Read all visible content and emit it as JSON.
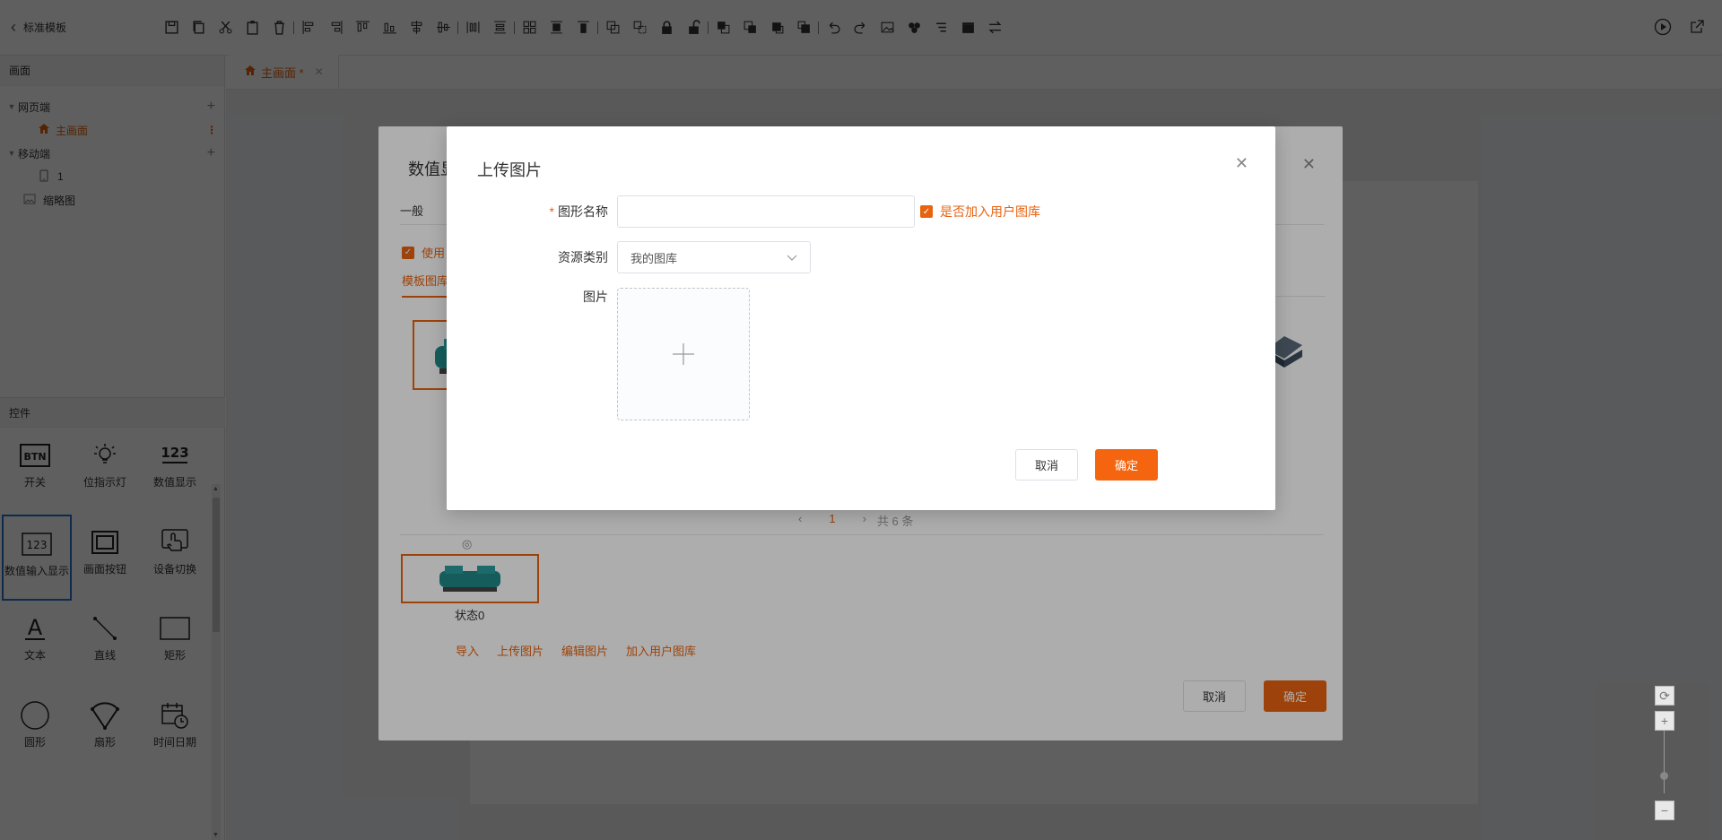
{
  "topbar": {
    "back_label": "标准模板"
  },
  "left": {
    "panel_title": "画面",
    "web_group": "网页端",
    "main_page": "主画面",
    "mobile_group": "移动端",
    "mobile_item": "1",
    "thumbnail": "缩略图",
    "controls_title": "控件",
    "controls": [
      {
        "label": "开关",
        "icon": "btn-icon"
      },
      {
        "label": "位指示灯",
        "icon": "bulb-icon"
      },
      {
        "label": "数值显示",
        "icon": "number-display-icon"
      },
      {
        "label": "数值输入显示",
        "icon": "number-input-icon"
      },
      {
        "label": "画面按钮",
        "icon": "frame-button-icon"
      },
      {
        "label": "设备切换",
        "icon": "device-switch-icon"
      },
      {
        "label": "文本",
        "icon": "text-icon"
      },
      {
        "label": "直线",
        "icon": "line-icon"
      },
      {
        "label": "矩形",
        "icon": "rectangle-icon"
      },
      {
        "label": "圆形",
        "icon": "circle-icon"
      },
      {
        "label": "扇形",
        "icon": "sector-icon"
      },
      {
        "label": "时间日期",
        "icon": "datetime-icon"
      }
    ]
  },
  "tabs": {
    "main_tab": "主画面 *"
  },
  "dialog_back": {
    "title": "数值显",
    "tab_general": "一般",
    "use_label": "使用",
    "subtab": "模板图库",
    "pager_current": "1",
    "pager_total": "共 6 条",
    "state_label": "状态0",
    "links": [
      "导入",
      "上传图片",
      "编辑图片",
      "加入用户图库"
    ],
    "cancel": "取消",
    "ok": "确定"
  },
  "dialog_upload": {
    "title": "上传图片",
    "name_required": "*",
    "name_label": "图形名称",
    "name_value": "",
    "add_to_user_lib": "是否加入用户图库",
    "category_label": "资源类别",
    "category_value": "我的图库",
    "image_label": "图片",
    "cancel": "取消",
    "ok": "确定"
  },
  "colors": {
    "accent": "#e8620f",
    "selected_border": "#2b73c9"
  }
}
